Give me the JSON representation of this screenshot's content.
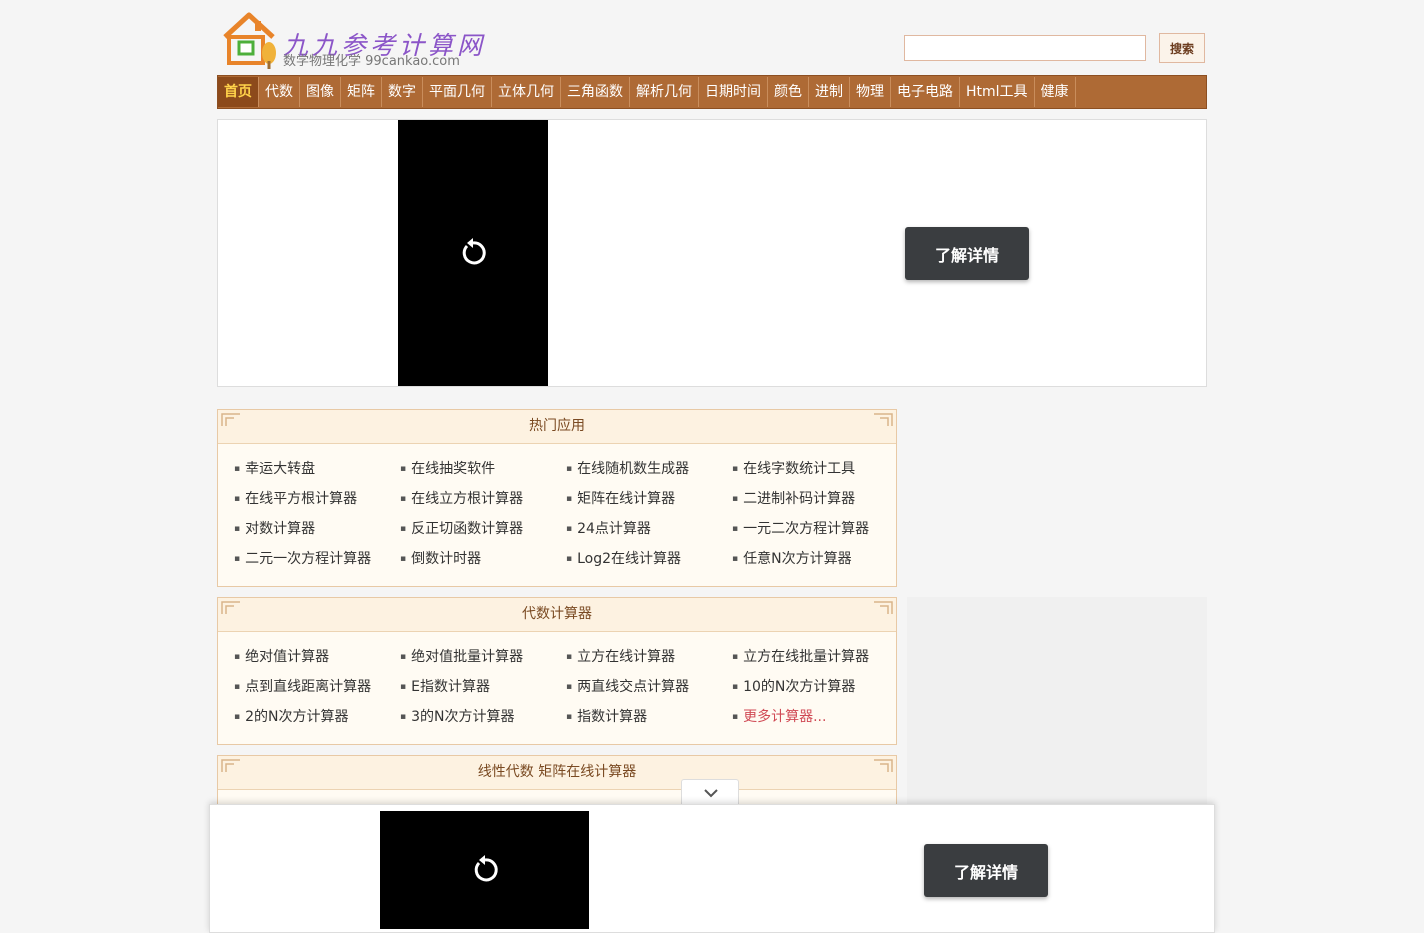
{
  "header": {
    "logo_title": "九九参考计算网",
    "logo_subtitle": "数学物理化学 99cankao.com",
    "search_placeholder": "",
    "search_button": "搜索"
  },
  "nav": {
    "items": [
      "首页",
      "代数",
      "图像",
      "矩阵",
      "数字",
      "平面几何",
      "立体几何",
      "三角函数",
      "解析几何",
      "日期时间",
      "颜色",
      "进制",
      "物理",
      "电子电路",
      "Html工具",
      "健康"
    ],
    "active_index": 0
  },
  "ad": {
    "button_label": "了解详情"
  },
  "panels": {
    "hot": {
      "title": "热门应用",
      "items": [
        "幸运大转盘",
        "在线抽奖软件",
        "在线随机数生成器",
        "在线字数统计工具",
        "在线平方根计算器",
        "在线立方根计算器",
        "矩阵在线计算器",
        "二进制补码计算器",
        "对数计算器",
        "反正切函数计算器",
        "24点计算器",
        "一元二次方程计算器",
        "二元一次方程计算器",
        "倒数计时器",
        "Log2在线计算器",
        "任意N次方计算器"
      ]
    },
    "algebra": {
      "title": "代数计算器",
      "items": [
        "绝对值计算器",
        "绝对值批量计算器",
        "立方在线计算器",
        "立方在线批量计算器",
        "点到直线距离计算器",
        "E指数计算器",
        "两直线交点计算器",
        "10的N次方计算器",
        "2的N次方计算器",
        "3的N次方计算器",
        "指数计算器"
      ],
      "more": "更多计算器..."
    },
    "matrix": {
      "title": "线性代数 矩阵在线计算器"
    }
  },
  "bottom_ad": {
    "button_label": "了解详情"
  },
  "colors": {
    "nav_bg": "#ae6a35",
    "nav_active_text": "#ffd24a",
    "logo_purple": "#8b55c8",
    "more_link": "#d04a55"
  }
}
